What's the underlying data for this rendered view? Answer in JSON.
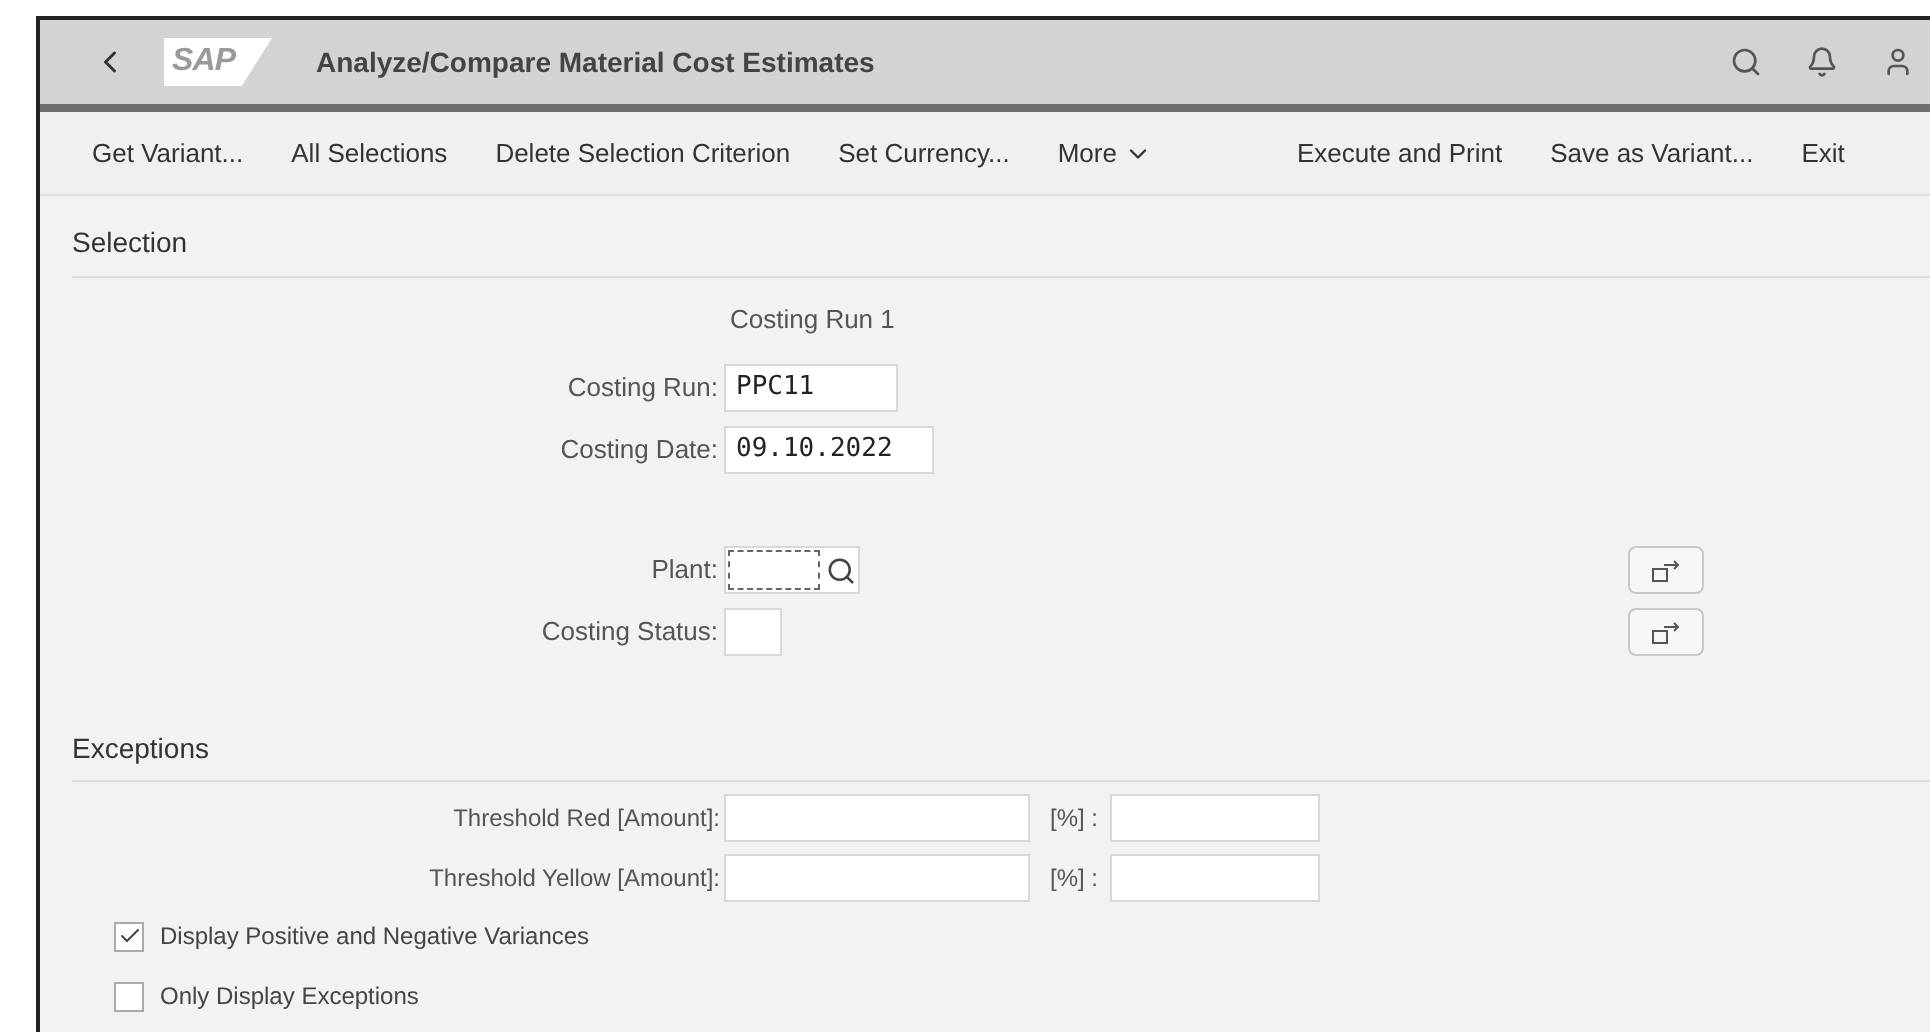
{
  "header": {
    "logo": "SAP",
    "title": "Analyze/Compare Material Cost Estimates"
  },
  "toolbar": [
    {
      "label": "Get Variant...",
      "kind": "button"
    },
    {
      "label": "All Selections",
      "kind": "button"
    },
    {
      "label": "Delete Selection Criterion",
      "kind": "button"
    },
    {
      "label": "Set Currency...",
      "kind": "button"
    },
    {
      "label": "More",
      "kind": "menu"
    },
    {
      "label": "Execute and Print",
      "kind": "button"
    },
    {
      "label": "Save as Variant...",
      "kind": "button"
    },
    {
      "label": "Exit",
      "kind": "button"
    }
  ],
  "selection": {
    "title": "Selection",
    "group_label": "Costing Run 1",
    "fields": [
      {
        "label": "Costing Run:",
        "value": "PPC11",
        "kind": "short"
      },
      {
        "label": "Costing Date:",
        "value": "09.10.2022",
        "kind": "date"
      },
      {
        "label": "Plant:",
        "kind": "search",
        "focused": true
      },
      {
        "label": "Costing Status:",
        "kind": "tiny"
      }
    ]
  },
  "exceptions": {
    "title": "Exceptions",
    "thresholds": [
      {
        "label": "Threshold Red [Amount]:",
        "percent_label": "[%] :"
      },
      {
        "label": "Threshold Yellow [Amount]:",
        "percent_label": "[%] :"
      }
    ],
    "checkboxes": [
      {
        "label": "Display Positive and Negative Variances",
        "checked": true
      },
      {
        "label": "Only Display Exceptions",
        "checked": false
      }
    ]
  }
}
